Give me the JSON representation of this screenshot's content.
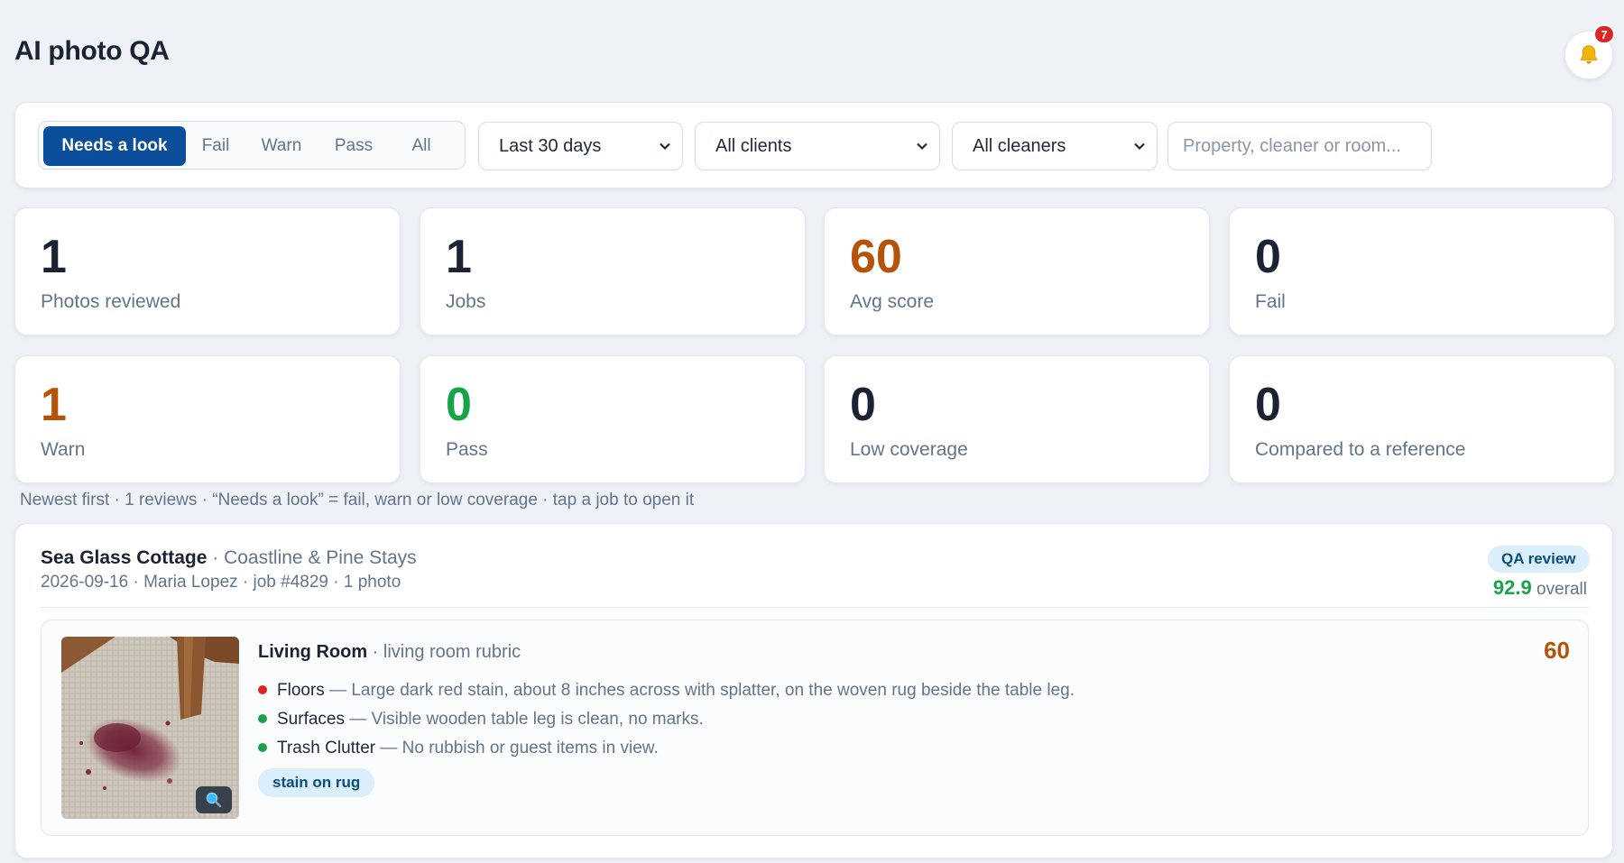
{
  "header": {
    "title": "AI photo QA",
    "notifications_count": "7",
    "bell_icon": "bell-icon"
  },
  "filters": {
    "tabs": [
      {
        "label": "Needs a look",
        "active": true
      },
      {
        "label": "Fail",
        "active": false
      },
      {
        "label": "Warn",
        "active": false
      },
      {
        "label": "Pass",
        "active": false
      },
      {
        "label": "All",
        "active": false
      }
    ],
    "date_range": "Last 30 days",
    "client": "All clients",
    "cleaner": "All cleaners",
    "search_placeholder": "Property, cleaner or room..."
  },
  "stats": [
    {
      "value": "1",
      "label": "Photos reviewed",
      "color": "#1a2233"
    },
    {
      "value": "1",
      "label": "Jobs",
      "color": "#1a2233"
    },
    {
      "value": "60",
      "label": "Avg score",
      "color": "#b45309"
    },
    {
      "value": "0",
      "label": "Fail",
      "color": "#1a2233"
    },
    {
      "value": "1",
      "label": "Warn",
      "color": "#b45309"
    },
    {
      "value": "0",
      "label": "Pass",
      "color": "#16a34a"
    },
    {
      "value": "0",
      "label": "Low coverage",
      "color": "#1a2233"
    },
    {
      "value": "0",
      "label": "Compared to a reference",
      "color": "#1a2233"
    }
  ],
  "summary": "Newest first · 1 reviews · “Needs a look” = fail, warn or low coverage · tap a job to open it",
  "job": {
    "property": "Sea Glass Cottage",
    "client": " · Coastline & Pine Stays",
    "meta": "2026-09-16 · Maria Lopez · job #4829 · 1 photo",
    "badge": "QA review",
    "overall_score": "92.9",
    "overall_label": " overall",
    "photo": {
      "room": "Living Room",
      "rubric": " · living room rubric",
      "score": "60",
      "zoom_icon": "magnifier-icon",
      "findings": [
        {
          "name": "Floors",
          "desc": " — Large dark red stain, about 8 inches across with splatter, on the woven rug beside the table leg.",
          "status": "red"
        },
        {
          "name": "Surfaces",
          "desc": " — Visible wooden table leg is clean, no marks.",
          "status": "green"
        },
        {
          "name": "Trash Clutter",
          "desc": " — No rubbish or guest items in view.",
          "status": "green"
        }
      ],
      "tag": "stain on rug"
    }
  },
  "colors": {
    "accent": "#0b4f9c",
    "warn": "#b45309",
    "pass": "#16a34a",
    "fail": "#dc2626"
  }
}
